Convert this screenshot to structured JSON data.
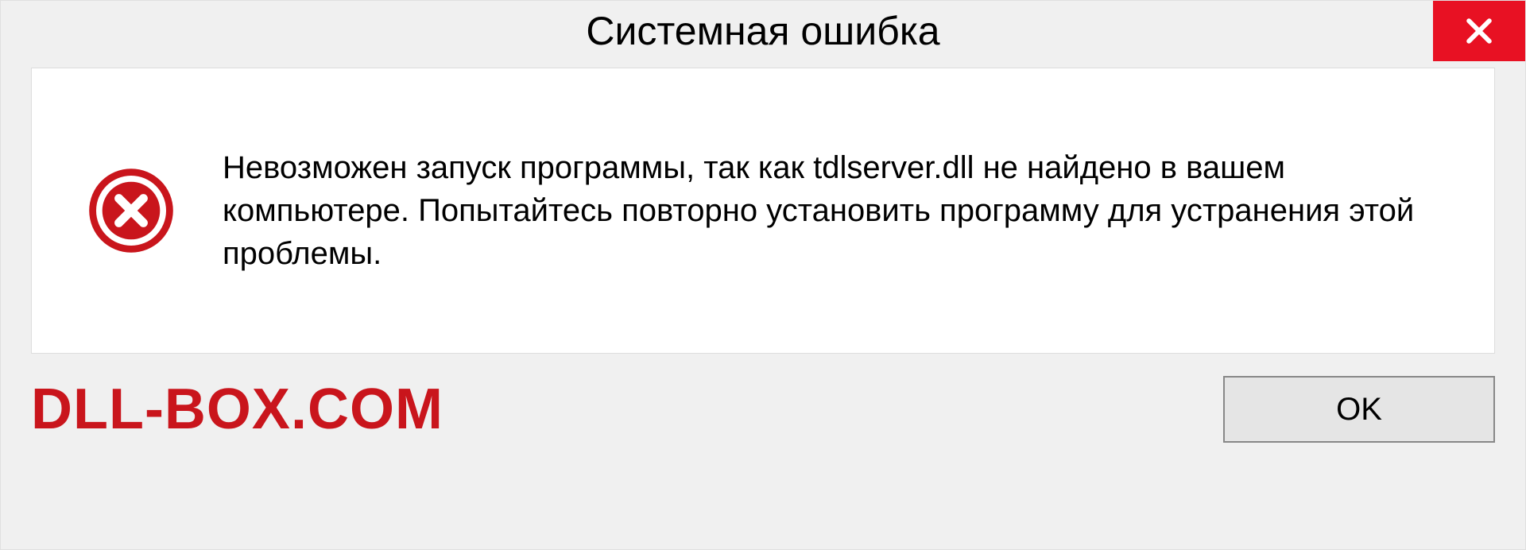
{
  "dialog": {
    "title": "Системная ошибка",
    "message": "Невозможен запуск программы, так как tdlserver.dll  не найдено в вашем компьютере. Попытайтесь повторно установить программу для устранения этой проблемы.",
    "ok_label": "OK"
  },
  "watermark": "DLL-BOX.COM"
}
